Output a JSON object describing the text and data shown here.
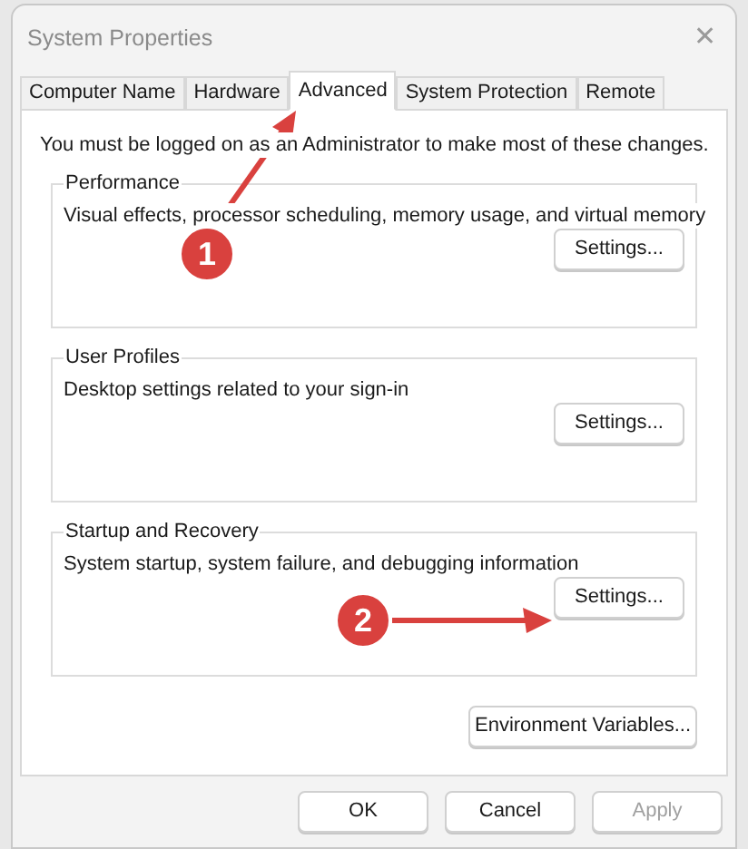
{
  "window": {
    "title": "System Properties",
    "close": "✕"
  },
  "tabs": [
    {
      "label": "Computer Name",
      "selected": false
    },
    {
      "label": "Hardware",
      "selected": false
    },
    {
      "label": "Advanced",
      "selected": true
    },
    {
      "label": "System Protection",
      "selected": false
    },
    {
      "label": "Remote",
      "selected": false
    }
  ],
  "notice": "You must be logged on as an Administrator to make most of these changes.",
  "groups": [
    {
      "title": "Performance",
      "description": "Visual effects, processor scheduling, memory usage, and virtual memory",
      "button": "Settings..."
    },
    {
      "title": "User Profiles",
      "description": "Desktop settings related to your sign-in",
      "button": "Settings..."
    },
    {
      "title": "Startup and Recovery",
      "description": "System startup, system failure, and debugging information",
      "button": "Settings..."
    }
  ],
  "environment_button": "Environment Variables...",
  "buttons": [
    {
      "label": "OK",
      "disabled": false
    },
    {
      "label": "Cancel",
      "disabled": false
    },
    {
      "label": "Apply",
      "disabled": true
    }
  ],
  "callouts": [
    {
      "number": "1"
    },
    {
      "number": "2"
    }
  ]
}
